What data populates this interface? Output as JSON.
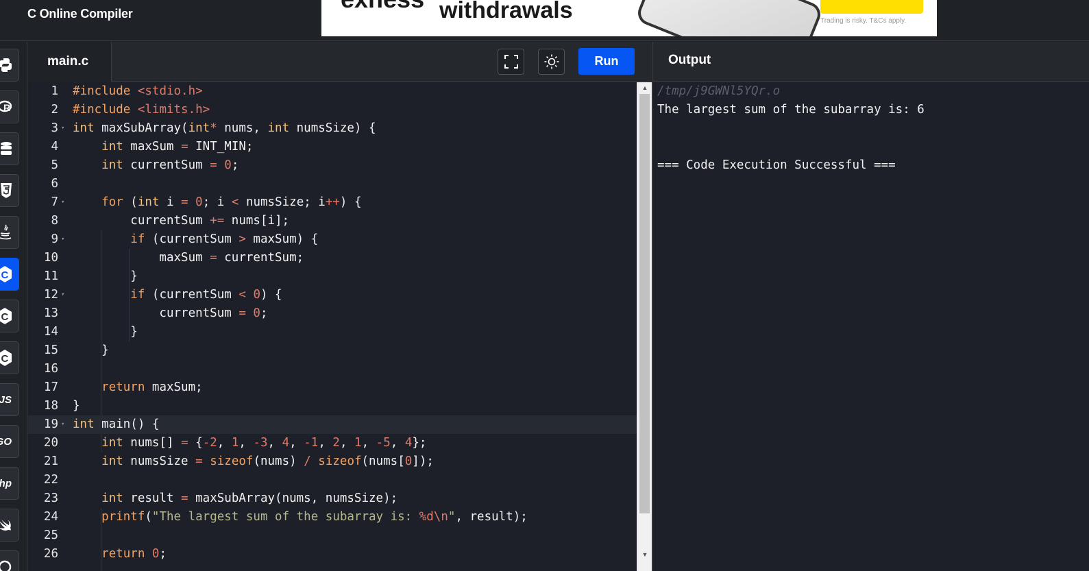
{
  "app": {
    "title": "C Online Compiler"
  },
  "ad": {
    "brand": "exness",
    "headline": "withdrawals",
    "disclaimer": "Trading is risky. T&Cs apply."
  },
  "sidebar": {
    "languages": [
      {
        "name": "python",
        "icon": "python-icon"
      },
      {
        "name": "r",
        "icon": "r-icon"
      },
      {
        "name": "sql",
        "icon": "database-icon"
      },
      {
        "name": "html",
        "icon": "html5-icon"
      },
      {
        "name": "java",
        "icon": "java-icon"
      },
      {
        "name": "c",
        "icon": "c-icon",
        "active": true
      },
      {
        "name": "cpp",
        "icon": "cpp-icon"
      },
      {
        "name": "csharp",
        "icon": "csharp-icon"
      },
      {
        "name": "javascript",
        "label": "JS"
      },
      {
        "name": "go",
        "label": "GO"
      },
      {
        "name": "php",
        "label": "hp"
      },
      {
        "name": "swift",
        "icon": "swift-icon"
      },
      {
        "name": "rust",
        "icon": "rust-icon"
      }
    ]
  },
  "editor": {
    "tab_label": "main.c",
    "run_label": "Run",
    "active_line": 19
  },
  "output": {
    "title": "Output",
    "path": "/tmp/j9GWNl5YQr.o",
    "result": "The largest sum of the subarray is: 6",
    "status": "=== Code Execution Successful ==="
  },
  "colors": {
    "accent": "#0556f3",
    "background": "#1d2029",
    "keyword": "#f4a261",
    "number": "#e07b6a",
    "string": "#b5b88a"
  }
}
